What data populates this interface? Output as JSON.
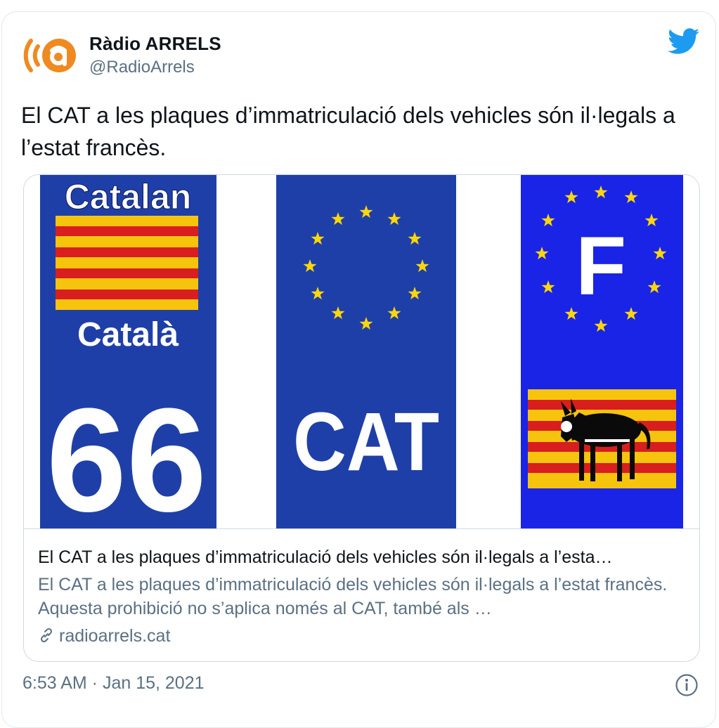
{
  "header": {
    "display_name": "Ràdio ARRELS",
    "handle": "@RadioArrels",
    "avatar_icon": "radio-arrels-logo",
    "platform_icon": "twitter-bird-icon"
  },
  "tweet_text": "El CAT a les plaques d’immatriculació dels vehicles són il·legals a l’estat francès.",
  "card": {
    "image": {
      "panel1_top": "Catalan",
      "panel1_mid": "Català",
      "panel1_number": "66",
      "panel2_code": "CAT",
      "panel3_letter": "F"
    },
    "title": "El CAT a les plaques d’immatriculació dels vehicles són il·legals a l’esta…",
    "description": "El CAT a les plaques d’immatriculació dels vehicles són il·legals a l’estat francès.  Aquesta prohibició no s’aplica només al CAT, també als …",
    "domain": "radioarrels.cat",
    "link_icon": "link-icon"
  },
  "footer": {
    "timestamp": "6:53 AM · Jan 15, 2021",
    "info_icon": "info-icon"
  },
  "colors": {
    "plate_blue": "#1f3fa8",
    "plate_blue_bright": "#1a24e6",
    "star_yellow": "#ffd60a",
    "flag_red": "#d81e1e",
    "flag_yellow": "#f6c40d",
    "twitter_blue": "#1d9bf0",
    "avatar_orange": "#ef8a21",
    "muted_text": "#5b7083"
  }
}
